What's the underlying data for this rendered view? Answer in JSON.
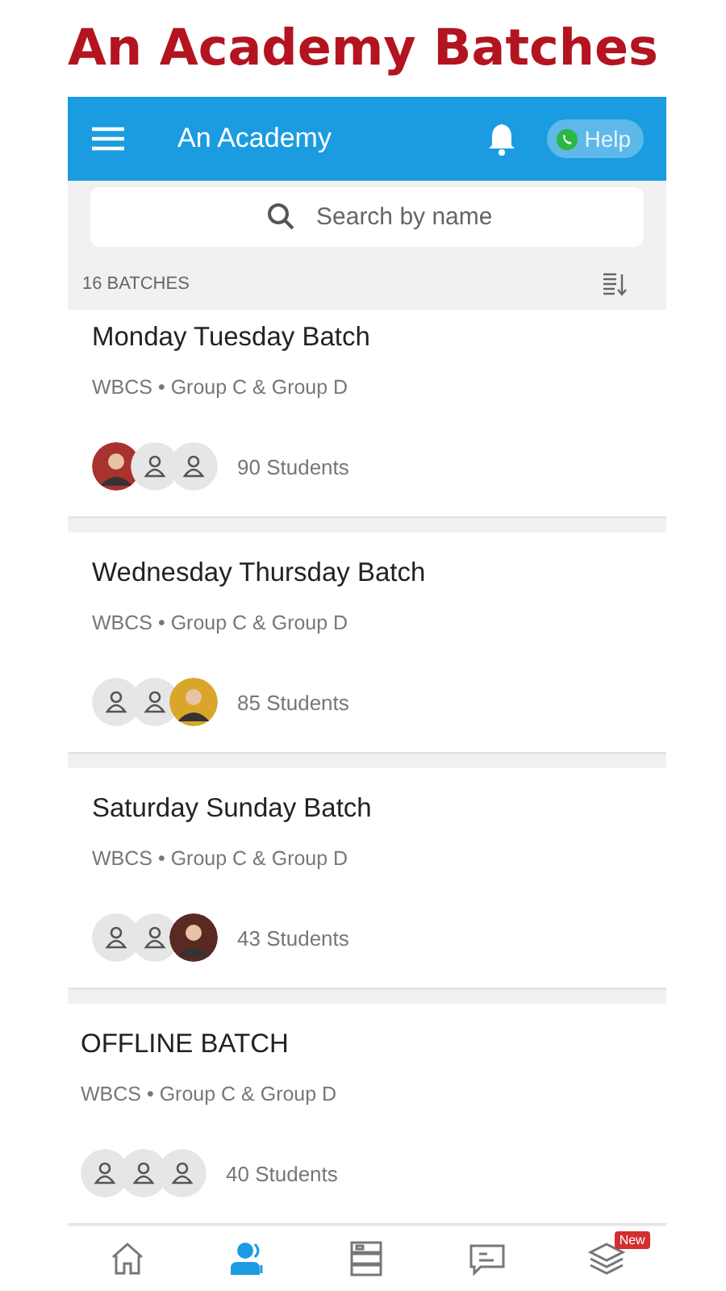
{
  "heading": "An Academy Batches",
  "app_bar": {
    "title": "An Academy",
    "help": "Help"
  },
  "search": {
    "placeholder": "Search by name"
  },
  "count": "16 BATCHES",
  "batches": [
    {
      "name": "Monday Tuesday Batch",
      "subtitle": "WBCS • Group C & Group D",
      "students": "90 Students",
      "avatars": [
        {
          "kind": "photo",
          "color": "#a8322e"
        },
        {
          "kind": "placeholder"
        },
        {
          "kind": "placeholder"
        }
      ]
    },
    {
      "name": "Wednesday Thursday Batch",
      "subtitle": "WBCS • Group C & Group D",
      "students": "85 Students",
      "avatars": [
        {
          "kind": "placeholder"
        },
        {
          "kind": "placeholder"
        },
        {
          "kind": "photo",
          "color": "#d9a62a"
        }
      ]
    },
    {
      "name": "Saturday Sunday Batch",
      "subtitle": "WBCS • Group C & Group D",
      "students": "43 Students",
      "avatars": [
        {
          "kind": "placeholder"
        },
        {
          "kind": "placeholder"
        },
        {
          "kind": "photo",
          "color": "#5a2a22"
        }
      ]
    },
    {
      "name": "OFFLINE BATCH",
      "subtitle": "WBCS • Group C & Group D",
      "students": "40 Students",
      "avatars": [
        {
          "kind": "placeholder"
        },
        {
          "kind": "placeholder"
        },
        {
          "kind": "placeholder"
        }
      ]
    }
  ],
  "nav": [
    {
      "kind": "home",
      "selected": false
    },
    {
      "kind": "people",
      "selected": true
    },
    {
      "kind": "books",
      "selected": false
    },
    {
      "kind": "chat",
      "selected": false
    },
    {
      "kind": "layers",
      "selected": false,
      "badge": "New"
    }
  ]
}
